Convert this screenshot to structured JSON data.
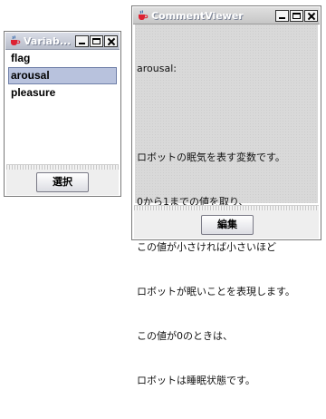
{
  "variable_window": {
    "title": "Variab...",
    "items": [
      {
        "label": "flag",
        "selected": false
      },
      {
        "label": "arousal",
        "selected": true
      },
      {
        "label": "pleasure",
        "selected": false
      }
    ],
    "select_button": "選択"
  },
  "comment_window": {
    "title": "CommentViewer",
    "lines": [
      "arousal:",
      "",
      "ロボットの眠気を表す変数です。",
      "0から1までの値を取り、",
      "この値が小さければ小さいほど",
      "ロボットが眠いことを表現します。",
      "この値が0のときは、",
      "ロボットは睡眠状態です。"
    ],
    "edit_button": "編集"
  },
  "colors": {
    "selection": "#b8c2dd",
    "title_active": "#b8bdca"
  },
  "icons": [
    "java-cup-icon",
    "minimize-icon",
    "maximize-icon",
    "close-icon"
  ]
}
